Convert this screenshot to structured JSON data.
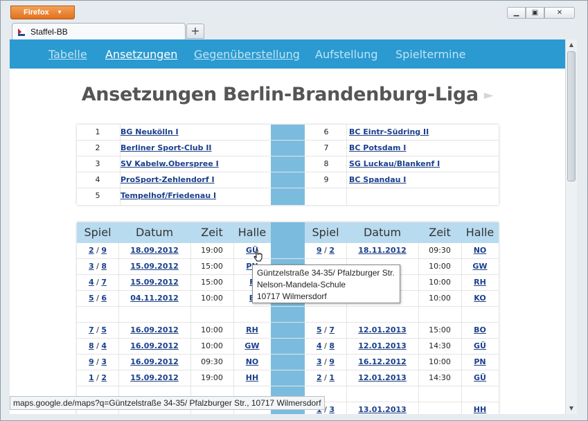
{
  "browser": {
    "menu_button": "Firefox",
    "tab_title": "Staffel-BB",
    "new_tab": "+",
    "status_url": "maps.google.de/maps?q=Güntzelstraße 34-35/ Pfalzburger Str., 10717 Wilmersdorf"
  },
  "nav": {
    "items": [
      "Tabelle",
      "Ansetzungen",
      "Gegenüberstellung",
      "Aufstellung",
      "Spieltermine"
    ]
  },
  "page_title": "Ansetzungen Berlin-Brandenburg-Liga",
  "teams": {
    "left": [
      {
        "num": "1",
        "name": "BG Neukölln I"
      },
      {
        "num": "2",
        "name": "Berliner Sport-Club II"
      },
      {
        "num": "3",
        "name": "SV Kabelw.Oberspree I"
      },
      {
        "num": "4",
        "name": "ProSport-Zehlendorf I"
      },
      {
        "num": "5",
        "name": "Tempelhof/Friedenau I"
      }
    ],
    "right": [
      {
        "num": "6",
        "name": "BC Eintr-Südring II"
      },
      {
        "num": "7",
        "name": "BC Potsdam I"
      },
      {
        "num": "8",
        "name": "SG Luckau/Blankenf I"
      },
      {
        "num": "9",
        "name": "BC Spandau I"
      },
      {
        "num": "",
        "name": ""
      }
    ]
  },
  "schedule": {
    "headers": [
      "Spiel",
      "Datum",
      "Zeit",
      "Halle",
      "Spiel",
      "Datum",
      "Zeit",
      "Halle"
    ],
    "rows": [
      {
        "l_a": "2",
        "l_b": "9",
        "l_date": "18.09.2012",
        "l_time": "19:00",
        "l_hall": "GÜ",
        "r_a": "9",
        "r_b": "2",
        "r_date": "18.11.2012",
        "r_time": "09:30",
        "r_hall": "NO"
      },
      {
        "l_a": "3",
        "l_b": "8",
        "l_date": "15.09.2012",
        "l_time": "15:00",
        "l_hall": "PN",
        "r_a": "",
        "r_b": "",
        "r_date": "",
        "r_time": "10:00",
        "r_hall": "GW"
      },
      {
        "l_a": "4",
        "l_b": "7",
        "l_date": "15.09.2012",
        "l_time": "15:00",
        "l_hall": "F",
        "r_a": "",
        "r_b": "",
        "r_date": "",
        "r_time": "10:00",
        "r_hall": "RH"
      },
      {
        "l_a": "5",
        "l_b": "6",
        "l_date": "04.11.2012",
        "l_time": "10:00",
        "l_hall": "B",
        "r_a": "",
        "r_b": "",
        "r_date": "",
        "r_time": "10:00",
        "r_hall": "KO"
      },
      {
        "l_a": "",
        "l_b": "",
        "l_date": "",
        "l_time": "",
        "l_hall": "",
        "r_a": "",
        "r_b": "",
        "r_date": "",
        "r_time": "",
        "r_hall": ""
      },
      {
        "l_a": "7",
        "l_b": "5",
        "l_date": "16.09.2012",
        "l_time": "10:00",
        "l_hall": "RH",
        "r_a": "5",
        "r_b": "7",
        "r_date": "12.01.2013",
        "r_time": "15:00",
        "r_hall": "BO"
      },
      {
        "l_a": "8",
        "l_b": "4",
        "l_date": "16.09.2012",
        "l_time": "10:00",
        "l_hall": "GW",
        "r_a": "4",
        "r_b": "8",
        "r_date": "12.01.2013",
        "r_time": "14:30",
        "r_hall": "GÜ"
      },
      {
        "l_a": "9",
        "l_b": "3",
        "l_date": "16.09.2012",
        "l_time": "09:30",
        "l_hall": "NO",
        "r_a": "3",
        "r_b": "9",
        "r_date": "16.12.2012",
        "r_time": "10:00",
        "r_hall": "PN"
      },
      {
        "l_a": "1",
        "l_b": "2",
        "l_date": "15.09.2012",
        "l_time": "19:00",
        "l_hall": "HH",
        "r_a": "2",
        "r_b": "1",
        "r_date": "12.01.2013",
        "r_time": "14:30",
        "r_hall": "GÜ"
      },
      {
        "l_a": "",
        "l_b": "",
        "l_date": "",
        "l_time": "",
        "l_hall": "",
        "r_a": "",
        "r_b": "",
        "r_date": "",
        "r_time": "",
        "r_hall": ""
      },
      {
        "l_a": "",
        "l_b": "",
        "l_date": "",
        "l_time": "",
        "l_hall": "",
        "r_a": "1",
        "r_b": "3",
        "r_date": "13.01.2013",
        "r_time": "",
        "r_hall": "HH"
      }
    ]
  },
  "tooltip": {
    "lines": [
      "Güntzelstraße 34-35/ Pfalzburger Str.",
      "Nelson-Mandela-Schule",
      "10717 Wilmersdorf"
    ]
  },
  "colors": {
    "nav_bg": "#2a9ad0",
    "header_bg": "#b8dbef",
    "separator_col": "#7bbcde",
    "link": "#1a3f8a",
    "firefox_orange": "#e2711c"
  }
}
